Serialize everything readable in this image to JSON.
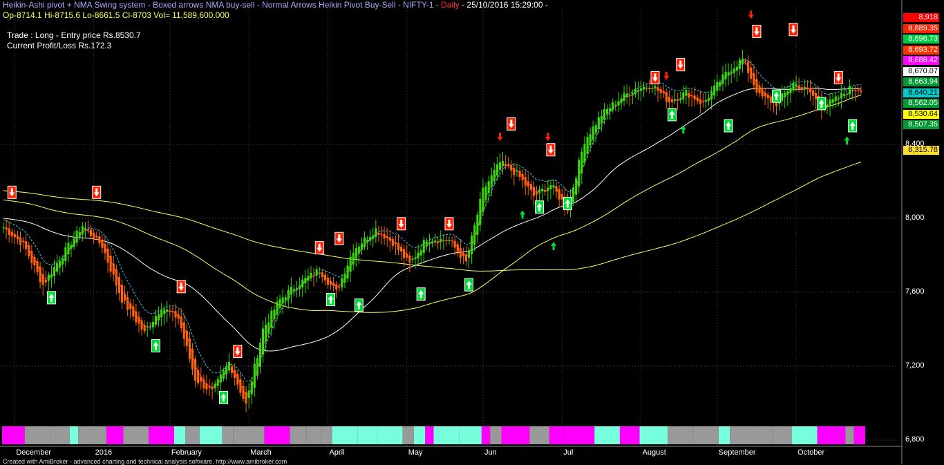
{
  "header": {
    "system_title": "Heikin-Ashi pivot + NMA Swing system - Boxed arrows NMA buy-sell - Normal Arrows Heikin Pivot Buy-Sell - NIFTY-1 -",
    "interval": "Daily",
    "datetime": "- 25/10/2016 15:29:00 -",
    "ohlcv": "Op-8714.1  Hi-8715.6  Lo-8661.5  Cl-8703  Vol= 11,589,600.000",
    "trade": "Trade : Long - Entry price Rs.8530.7",
    "profit": "Current Profit/Loss Rs.172.3"
  },
  "footer": "Created with AmiBroker - advanced charting and technical analysis software. http://www.amibroker.com",
  "colors": {
    "background": "#000000",
    "bull": "#33dd00",
    "bear": "#ff6600",
    "sell_arrow": "#ff2200",
    "buy_arrow": "#00dd33",
    "magenta": "#ff00ff",
    "cyan_dashed": "#33ccff",
    "white_ma": "#ffffff",
    "yellow_ma": "#ffff66",
    "ribbon_cyan": "#77ffdd",
    "ribbon_gray": "#999999"
  },
  "price_labels": [
    {
      "text": "8,918",
      "bg": "#ff0000",
      "fg": "#ffffff"
    },
    {
      "text": "8,889.35",
      "bg": "#ff2200",
      "fg": "#ffffff"
    },
    {
      "text": "8,696.73",
      "bg": "#00cc44",
      "fg": "#ffffff"
    },
    {
      "text": "8,693.72",
      "bg": "#ff3300",
      "fg": "#ffffff"
    },
    {
      "text": "8,688.42",
      "bg": "#ff00ff",
      "fg": "#ffffff"
    },
    {
      "text": "8,670.07",
      "bg": "#ffffff",
      "fg": "#000000"
    },
    {
      "text": "8,663.94",
      "bg": "#009933",
      "fg": "#ffffff"
    },
    {
      "text": "8,640.21",
      "bg": "#00cccc",
      "fg": "#000000"
    },
    {
      "text": "8,562.05",
      "bg": "#009933",
      "fg": "#ffffff"
    },
    {
      "text": "8,530.64",
      "bg": "#ffff00",
      "fg": "#000000"
    },
    {
      "text": "8,507.35",
      "bg": "#009933",
      "fg": "#ffffff"
    },
    {
      "text": "8,315.78",
      "bg": "#ffdd33",
      "fg": "#000000"
    }
  ],
  "chart_data": {
    "type": "candlestick",
    "series_names": [
      "Heikin-Ashi candles",
      "NMA buy-sell signals",
      "Heikin Pivot buy-sell signals"
    ],
    "y_ticks": [
      6800,
      7200,
      7600,
      8000,
      8400
    ],
    "y_tick_labels": [
      "6,800",
      "7,200",
      "7,600",
      "8,000",
      "8,400"
    ],
    "ylim": [
      6770,
      9150
    ],
    "x_labels": [
      {
        "text": "December",
        "month": 0
      },
      {
        "text": "2016",
        "month": 1
      },
      {
        "text": "February",
        "month": 2
      },
      {
        "text": "March",
        "month": 3
      },
      {
        "text": "April",
        "month": 4
      },
      {
        "text": "May",
        "month": 5
      },
      {
        "text": "Jun",
        "month": 6
      },
      {
        "text": "Jul",
        "month": 7
      },
      {
        "text": "August",
        "month": 8
      },
      {
        "text": "September",
        "month": 9
      },
      {
        "text": "October",
        "month": 10
      }
    ],
    "price_keypoints": [
      [
        0,
        7950
      ],
      [
        7,
        7860
      ],
      [
        14,
        7640
      ],
      [
        20,
        7780
      ],
      [
        28,
        7960
      ],
      [
        35,
        7850
      ],
      [
        42,
        7560
      ],
      [
        50,
        7380
      ],
      [
        56,
        7520
      ],
      [
        62,
        7460
      ],
      [
        68,
        7130
      ],
      [
        74,
        7060
      ],
      [
        80,
        7220
      ],
      [
        86,
        6990
      ],
      [
        92,
        7400
      ],
      [
        98,
        7560
      ],
      [
        104,
        7640
      ],
      [
        112,
        7720
      ],
      [
        118,
        7600
      ],
      [
        124,
        7830
      ],
      [
        132,
        7940
      ],
      [
        138,
        7870
      ],
      [
        144,
        7750
      ],
      [
        150,
        7890
      ],
      [
        158,
        7880
      ],
      [
        164,
        7760
      ],
      [
        170,
        8150
      ],
      [
        176,
        8300
      ],
      [
        182,
        8240
      ],
      [
        188,
        8120
      ],
      [
        194,
        8180
      ],
      [
        200,
        8050
      ],
      [
        206,
        8420
      ],
      [
        212,
        8560
      ],
      [
        218,
        8640
      ],
      [
        224,
        8700
      ],
      [
        230,
        8720
      ],
      [
        236,
        8630
      ],
      [
        242,
        8680
      ],
      [
        248,
        8620
      ],
      [
        256,
        8780
      ],
      [
        262,
        8860
      ],
      [
        268,
        8660
      ],
      [
        274,
        8620
      ],
      [
        280,
        8730
      ],
      [
        286,
        8680
      ],
      [
        290,
        8600
      ],
      [
        296,
        8650
      ],
      [
        300,
        8700
      ]
    ],
    "sell_signals": [
      {
        "bar": 3,
        "price": 8140,
        "boxed": true
      },
      {
        "bar": 33,
        "price": 8140,
        "boxed": true
      },
      {
        "bar": 63,
        "price": 7630,
        "boxed": true
      },
      {
        "bar": 83,
        "price": 7280,
        "boxed": true
      },
      {
        "bar": 112,
        "price": 7840,
        "boxed": true
      },
      {
        "bar": 119,
        "price": 7890,
        "boxed": true
      },
      {
        "bar": 141,
        "price": 7970,
        "boxed": true
      },
      {
        "bar": 158,
        "price": 7970,
        "boxed": true
      },
      {
        "bar": 176,
        "price": 8440,
        "arrow_only": true
      },
      {
        "bar": 180,
        "price": 8510,
        "boxed": true
      },
      {
        "bar": 193,
        "price": 8440,
        "arrow_only": true
      },
      {
        "bar": 194,
        "price": 8370,
        "boxed": true
      },
      {
        "bar": 231,
        "price": 8760,
        "boxed": true
      },
      {
        "bar": 235,
        "price": 8770,
        "arrow_only": true
      },
      {
        "bar": 240,
        "price": 8830,
        "boxed": true
      },
      {
        "bar": 265,
        "price": 9100,
        "arrow_only": true
      },
      {
        "bar": 267,
        "price": 9010,
        "boxed": true
      },
      {
        "bar": 280,
        "price": 9020,
        "boxed": true
      },
      {
        "bar": 296,
        "price": 8760,
        "boxed": true
      }
    ],
    "buy_signals": [
      {
        "bar": 17,
        "price": 7570,
        "boxed": true
      },
      {
        "bar": 54,
        "price": 7310,
        "boxed": true
      },
      {
        "bar": 78,
        "price": 7030,
        "boxed": true
      },
      {
        "bar": 89,
        "price": 6820,
        "boxed": true
      },
      {
        "bar": 116,
        "price": 7560,
        "boxed": true
      },
      {
        "bar": 126,
        "price": 7530,
        "boxed": true
      },
      {
        "bar": 148,
        "price": 7590,
        "boxed": true
      },
      {
        "bar": 165,
        "price": 7640,
        "boxed": true
      },
      {
        "bar": 184,
        "price": 8020,
        "arrow_only": true
      },
      {
        "bar": 190,
        "price": 8060,
        "boxed": true
      },
      {
        "bar": 195,
        "price": 7850,
        "arrow_only": true
      },
      {
        "bar": 200,
        "price": 8080,
        "boxed": true
      },
      {
        "bar": 237,
        "price": 8560,
        "boxed": true
      },
      {
        "bar": 241,
        "price": 8480,
        "arrow_only": true
      },
      {
        "bar": 257,
        "price": 8500,
        "boxed": true
      },
      {
        "bar": 274,
        "price": 8660,
        "boxed": true
      },
      {
        "bar": 290,
        "price": 8620,
        "boxed": true
      },
      {
        "bar": 301,
        "price": 8500,
        "boxed": true
      },
      {
        "bar": 299,
        "price": 8420,
        "arrow_only": true
      }
    ],
    "ribbon_colors": [
      "#ff00ff",
      "#77ffdd",
      "#999999"
    ],
    "num_bars": 305
  }
}
